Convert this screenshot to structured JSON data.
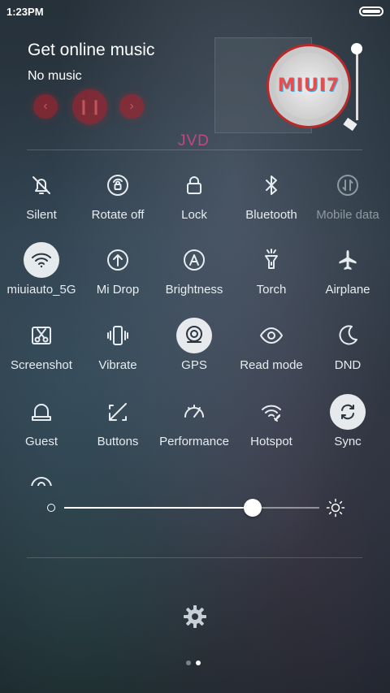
{
  "status_bar": {
    "time": "1:23PM"
  },
  "music": {
    "title": "Get online music",
    "subtitle": "No music",
    "album_label": "MIUI7",
    "controls": [
      "prev-icon",
      "pause-icon",
      "next-icon"
    ]
  },
  "watermark": "JVD",
  "toggles": [
    {
      "label": "Silent",
      "icon": "bell-off-icon",
      "on": false
    },
    {
      "label": "Rotate off",
      "icon": "rotate-lock-icon",
      "on": false
    },
    {
      "label": "Lock",
      "icon": "lock-icon",
      "on": false
    },
    {
      "label": "Bluetooth",
      "icon": "bluetooth-icon",
      "on": false
    },
    {
      "label": "Mobile data",
      "icon": "mobile-data-icon",
      "on": false,
      "disabled": true
    },
    {
      "label": "miuiauto_5G",
      "icon": "wifi-icon",
      "on": true
    },
    {
      "label": "Mi Drop",
      "icon": "mi-drop-icon",
      "on": false
    },
    {
      "label": "Brightness",
      "icon": "brightness-auto-icon",
      "on": false
    },
    {
      "label": "Torch",
      "icon": "torch-icon",
      "on": false
    },
    {
      "label": "Airplane",
      "icon": "airplane-icon",
      "on": false
    },
    {
      "label": "Screenshot",
      "icon": "scissors-icon",
      "on": false
    },
    {
      "label": "Vibrate",
      "icon": "vibrate-icon",
      "on": false
    },
    {
      "label": "GPS",
      "icon": "gps-icon",
      "on": true
    },
    {
      "label": "Read mode",
      "icon": "eye-icon",
      "on": false
    },
    {
      "label": "DND",
      "icon": "moon-icon",
      "on": false
    },
    {
      "label": "Guest",
      "icon": "guest-icon",
      "on": false
    },
    {
      "label": "Buttons",
      "icon": "buttons-icon",
      "on": false
    },
    {
      "label": "Performance",
      "icon": "speedometer-icon",
      "on": false
    },
    {
      "label": "Hotspot",
      "icon": "hotspot-icon",
      "on": false
    },
    {
      "label": "Sync",
      "icon": "sync-icon",
      "on": true
    }
  ],
  "brightness": {
    "level": 0.74
  },
  "pager": {
    "pages": 2,
    "current": 2
  },
  "colors": {
    "active_bg": "#e7eaec",
    "active_fg": "#2b3640",
    "accent_red": "#b82a2a",
    "watermark": "#c0497f"
  }
}
